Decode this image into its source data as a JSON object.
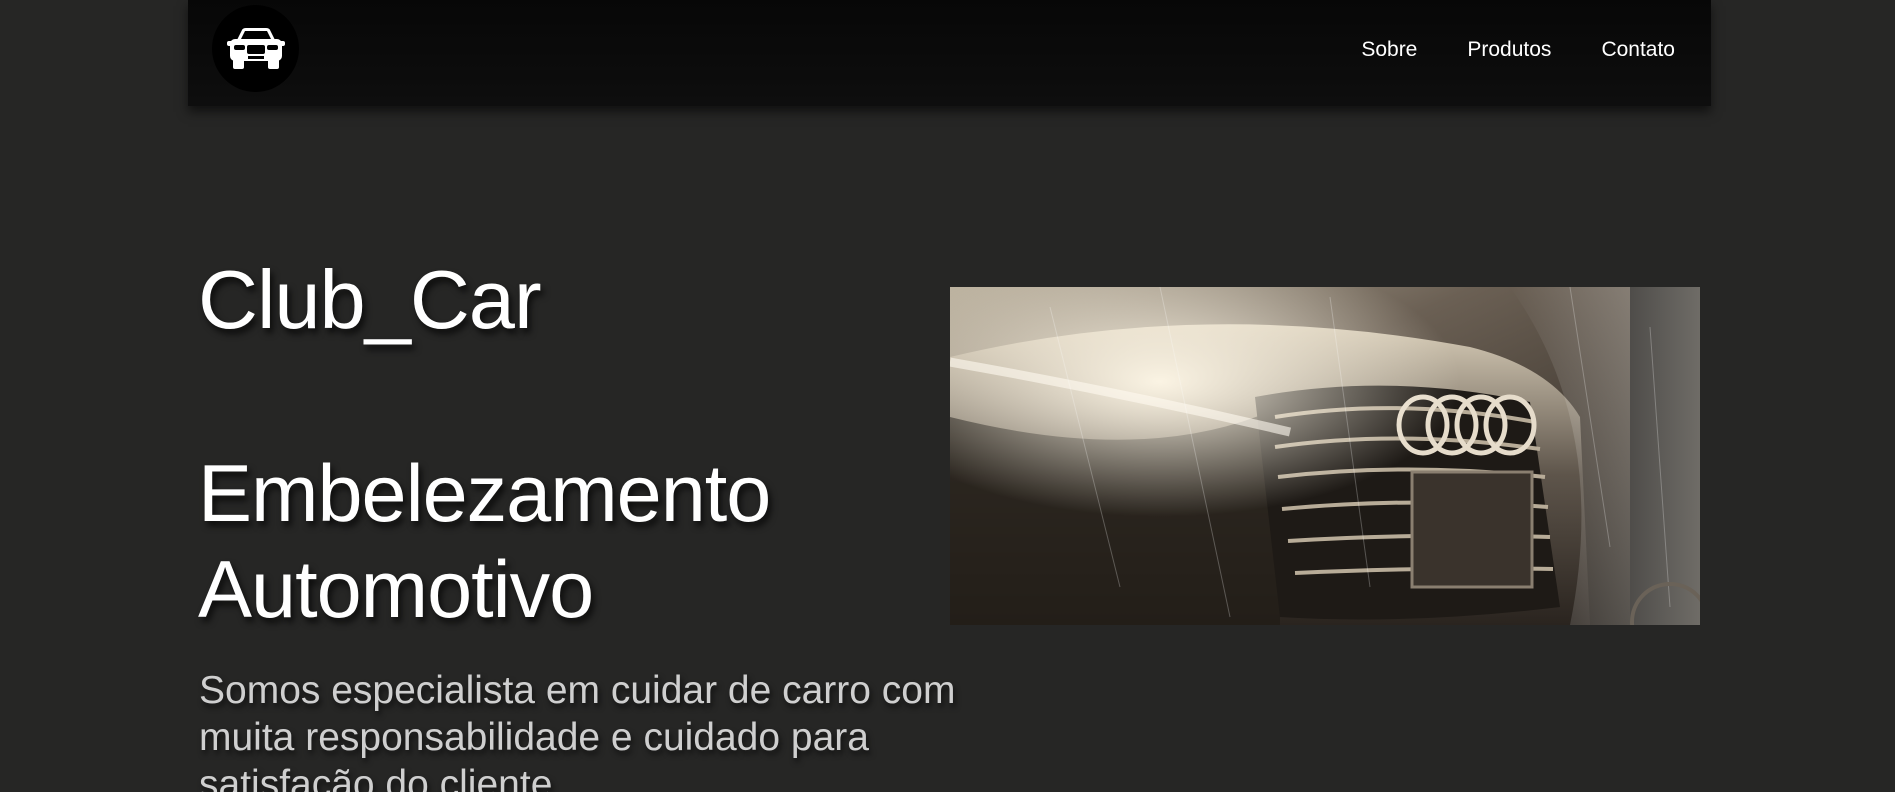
{
  "nav": {
    "logo_icon": "car-front-icon",
    "links": [
      "Sobre",
      "Produtos",
      "Contato"
    ]
  },
  "hero": {
    "brand": "Club_Car",
    "headline": "Embelezamento Automotivo",
    "description": "Somos especialista em cuidar de carro com muita responsabilidade e cuidado para satisfação do cliente",
    "image_icon": "car-wash-photo"
  },
  "colors": {
    "background": "#262625",
    "navbar": "#0a0a0a",
    "text": "#ffffff",
    "muted_text": "#cfcfcf"
  }
}
